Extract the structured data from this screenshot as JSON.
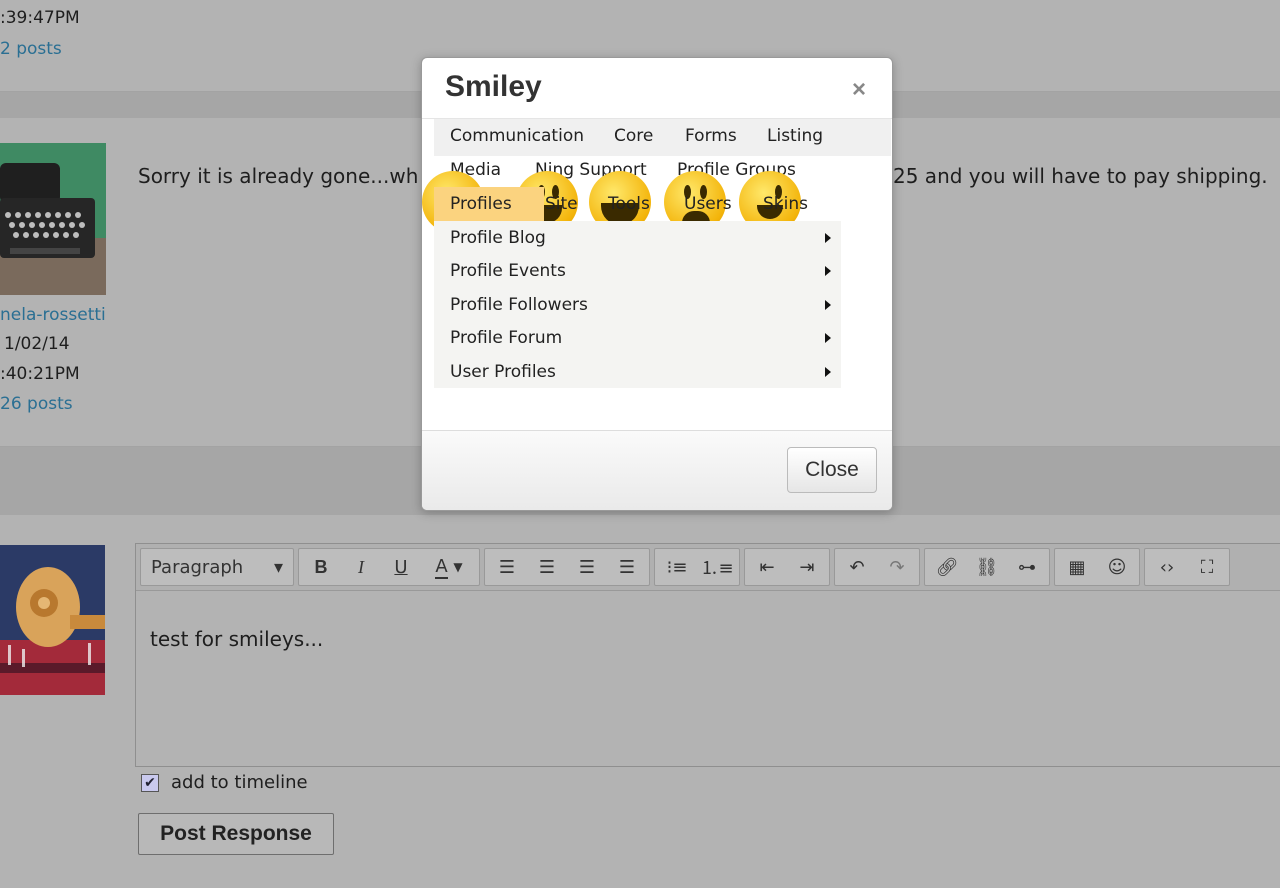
{
  "post1": {
    "time": ":39:47PM",
    "posts": "2 posts"
  },
  "post2": {
    "username": "nela-rossetti",
    "date": "1/02/14",
    "time": ":40:21PM",
    "posts": "26 posts",
    "message_left": "Sorry it is already gone...wh",
    "message_right": "25 and you will have to pay shipping."
  },
  "editor": {
    "format_select": "Paragraph",
    "content": "test for smileys...",
    "timeline_label": "add to timeline",
    "timeline_checked": true,
    "submit_label": "Post Response"
  },
  "modal": {
    "title": "Smiley",
    "close_x": "×",
    "menu": {
      "row1": [
        "Communication",
        "Core",
        "Forms",
        "Listing"
      ],
      "row2": [
        "Media",
        "Ning Support",
        "Profile Groups"
      ],
      "row3": [
        "Profiles",
        "Site",
        "Tools",
        "Users",
        "Skins"
      ],
      "active": "Profiles"
    },
    "submenu": [
      "Profile Blog",
      "Profile Events",
      "Profile Followers",
      "Profile Forum",
      "User Profiles"
    ],
    "close_button": "Close"
  },
  "colors": {
    "link": "#2a6f93",
    "active_menu": "#fbd37f",
    "overlay": "#b3b3b3"
  }
}
